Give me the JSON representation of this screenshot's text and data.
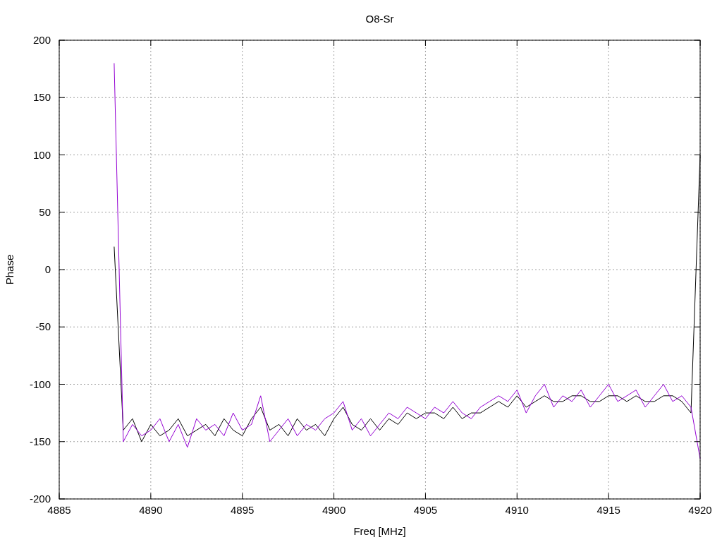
{
  "plot": {
    "chart_data": {
      "type": "line",
      "grid": true,
      "title": "O8-Sr",
      "xlabel": "Freq [MHz]",
      "ylabel": "Phase",
      "xlim": [
        4885,
        4920
      ],
      "ylim": [
        -200,
        200
      ],
      "xticks": [
        4885,
        4890,
        4895,
        4900,
        4905,
        4910,
        4915,
        4920
      ],
      "yticks": [
        -200,
        -150,
        -100,
        -50,
        0,
        50,
        100,
        150,
        200
      ],
      "x": [
        4888,
        4888.5,
        4889,
        4889.5,
        4890,
        4890.5,
        4891,
        4891.5,
        4892,
        4892.5,
        4893,
        4893.5,
        4894,
        4894.5,
        4895,
        4895.5,
        4896,
        4896.5,
        4897,
        4897.5,
        4898,
        4898.5,
        4899,
        4899.5,
        4900,
        4900.5,
        4901,
        4901.5,
        4902,
        4902.5,
        4903,
        4903.5,
        4904,
        4904.5,
        4905,
        4905.5,
        4906,
        4906.5,
        4907,
        4907.5,
        4908,
        4908.5,
        4909,
        4909.5,
        4910,
        4910.5,
        4911,
        4911.5,
        4912,
        4912.5,
        4913,
        4913.5,
        4914,
        4914.5,
        4915,
        4915.5,
        4916,
        4916.5,
        4917,
        4917.5,
        4918,
        4918.5,
        4919,
        4919.5,
        4920
      ],
      "series": [
        {
          "color": "#000000",
          "values": [
            20,
            -140,
            -130,
            -150,
            -135,
            -145,
            -140,
            -130,
            -145,
            -140,
            -135,
            -145,
            -130,
            -140,
            -145,
            -130,
            -120,
            -140,
            -135,
            -145,
            -130,
            -140,
            -135,
            -145,
            -130,
            -120,
            -135,
            -140,
            -130,
            -140,
            -130,
            -135,
            -125,
            -130,
            -125,
            -125,
            -130,
            -120,
            -130,
            -125,
            -125,
            -120,
            -115,
            -120,
            -110,
            -120,
            -115,
            -110,
            -115,
            -115,
            -110,
            -110,
            -115,
            -115,
            -110,
            -110,
            -115,
            -110,
            -115,
            -115,
            -110,
            -110,
            -115,
            -125,
            100
          ]
        },
        {
          "color": "#9400d3",
          "values": [
            180,
            -150,
            -135,
            -145,
            -140,
            -130,
            -150,
            -135,
            -155,
            -130,
            -140,
            -135,
            -145,
            -125,
            -140,
            -135,
            -110,
            -150,
            -140,
            -130,
            -145,
            -135,
            -140,
            -130,
            -125,
            -115,
            -140,
            -130,
            -145,
            -135,
            -125,
            -130,
            -120,
            -125,
            -130,
            -120,
            -125,
            -115,
            -125,
            -130,
            -120,
            -115,
            -110,
            -115,
            -105,
            -125,
            -110,
            -100,
            -120,
            -110,
            -115,
            -105,
            -120,
            -110,
            -100,
            -115,
            -110,
            -105,
            -120,
            -110,
            -100,
            -115,
            -110,
            -120,
            -165
          ]
        }
      ]
    }
  }
}
